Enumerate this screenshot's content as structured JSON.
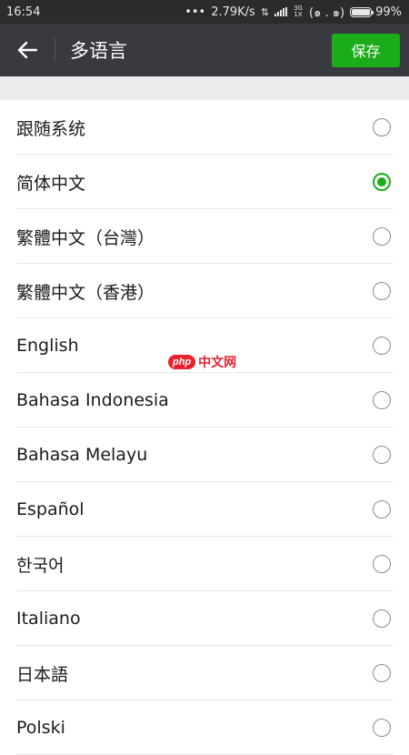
{
  "status_bar": {
    "time": "16:54",
    "dots": "•••",
    "speed": "2.79K/s",
    "network": "3G 1X",
    "circle_icons": "(๑ . ๑)",
    "battery_percent": "99%",
    "battery_level": 0.99
  },
  "app_bar": {
    "title": "多语言",
    "save_label": "保存",
    "back_icon": "arrow-left-icon"
  },
  "languages": [
    {
      "label": "跟随系统",
      "selected": false
    },
    {
      "label": "简体中文",
      "selected": true
    },
    {
      "label": "繁體中文（台灣）",
      "selected": false
    },
    {
      "label": "繁體中文（香港）",
      "selected": false
    },
    {
      "label": "English",
      "selected": false
    },
    {
      "label": "Bahasa Indonesia",
      "selected": false
    },
    {
      "label": "Bahasa Melayu",
      "selected": false
    },
    {
      "label": "Español",
      "selected": false
    },
    {
      "label": "한국어",
      "selected": false
    },
    {
      "label": "Italiano",
      "selected": false
    },
    {
      "label": "日本語",
      "selected": false
    },
    {
      "label": "Polski",
      "selected": false
    }
  ],
  "watermark": {
    "badge": "php",
    "text": "中文网"
  },
  "colors": {
    "accent": "#1aad19",
    "app_bar": "#393a3f",
    "status_bar": "#2b2b2b"
  }
}
